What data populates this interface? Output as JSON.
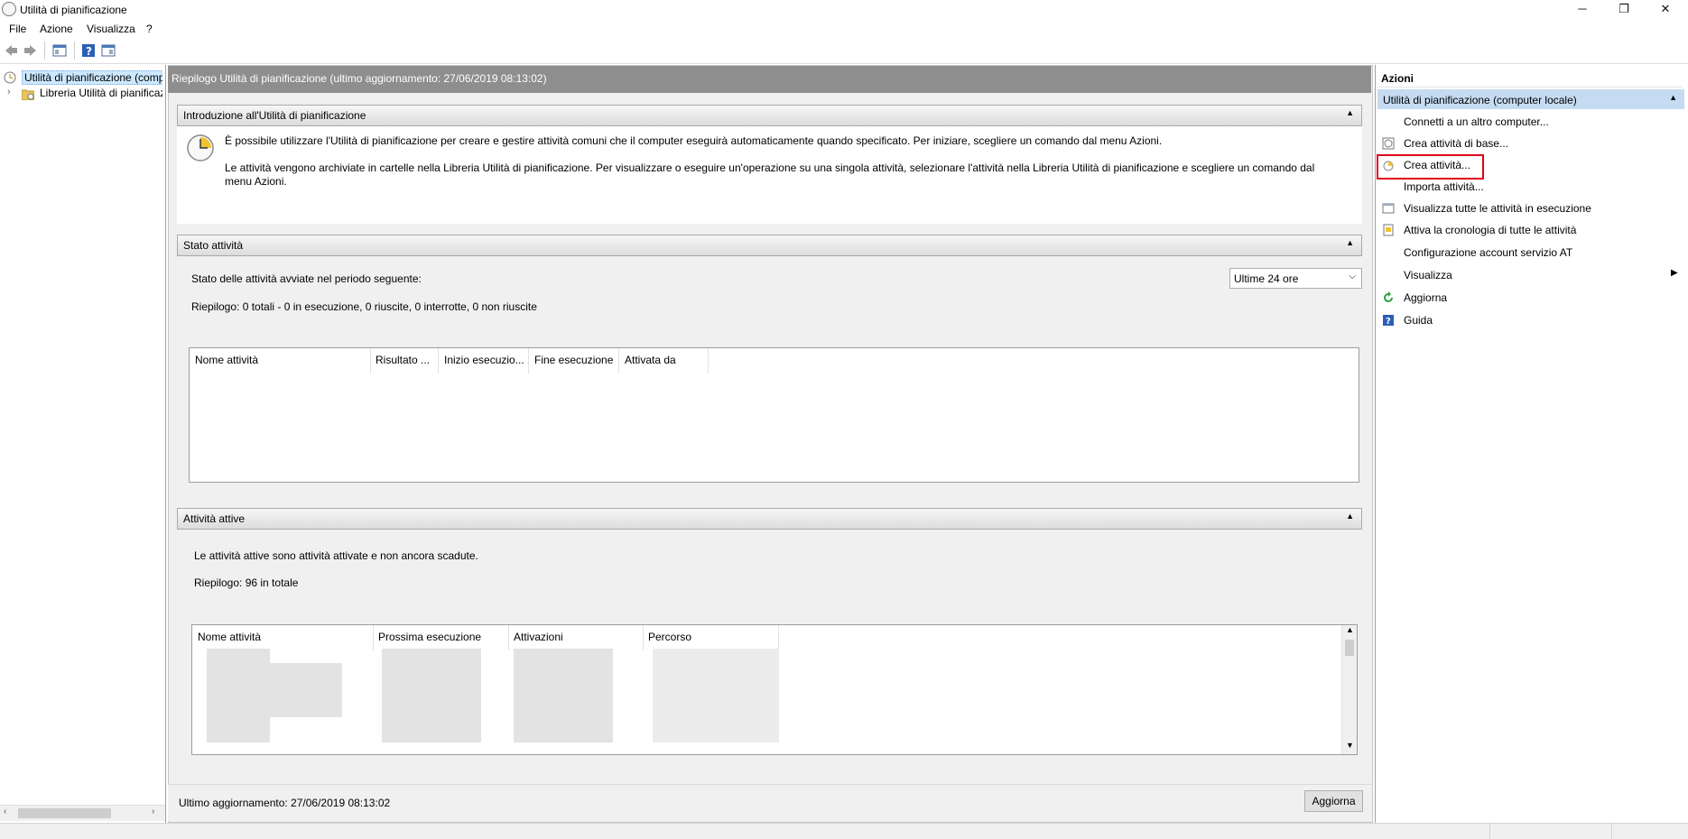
{
  "window": {
    "title": "Utilità di pianificazione",
    "minimize_glyph": "─",
    "restore_glyph": "❐",
    "close_glyph": "✕"
  },
  "menu": [
    "File",
    "Azione",
    "Visualizza",
    "?"
  ],
  "tree": {
    "root": "Utilità di pianificazione (computer locale)",
    "child": "Libreria Utilità di pianificazione"
  },
  "center": {
    "header": "Riepilogo Utilità di pianificazione (ultimo aggiornamento: 27/06/2019 08:13:02)",
    "intro": {
      "title": "Introduzione all'Utilità di pianificazione",
      "p1": "È possibile utilizzare l'Utilità di pianificazione per creare e gestire attività comuni che il computer eseguirà automaticamente quando specificato. Per iniziare, scegliere un comando dal menu Azioni.",
      "p2": "Le attività vengono archiviate in cartelle nella Libreria Utilità di pianificazione. Per visualizzare o eseguire un'operazione su una singola attività, selezionare l'attività nella Libreria Utilità di pianificazione e scegliere un comando dal menu Azioni."
    },
    "status": {
      "title": "Stato attività",
      "period_label": "Stato delle attività avviate nel periodo seguente:",
      "period_value": "Ultime 24 ore",
      "summary": "Riepilogo: 0 totali - 0 in esecuzione, 0 riuscite, 0 interrotte, 0 non riuscite",
      "columns": [
        "Nome attività",
        "Risultato ...",
        "Inizio esecuzio...",
        "Fine esecuzione",
        "Attivata da"
      ]
    },
    "active": {
      "title": "Attività attive",
      "desc": "Le attività attive sono attività attivate e non ancora scadute.",
      "summary": "Riepilogo: 96 in totale",
      "columns": [
        "Nome attività",
        "Prossima esecuzione",
        "Attivazioni",
        "Percorso"
      ]
    },
    "footer": {
      "last_update": "Ultimo aggiornamento: 27/06/2019 08:13:02",
      "refresh_button": "Aggiorna"
    }
  },
  "actions": {
    "title": "Azioni",
    "group": "Utilità di pianificazione (computer locale)",
    "items": [
      {
        "label": "Connetti a un altro computer...",
        "icon": "none"
      },
      {
        "label": "Crea attività di base...",
        "icon": "basic-task-icon"
      },
      {
        "label": "Crea attività...",
        "icon": "create-task-icon",
        "highlighted": true
      },
      {
        "label": "Importa attività...",
        "icon": "none"
      },
      {
        "label": "Visualizza tutte le attività in esecuzione",
        "icon": "running-tasks-icon"
      },
      {
        "label": "Attiva la cronologia di tutte le attività",
        "icon": "history-icon"
      },
      {
        "label": "Configurazione account servizio AT",
        "icon": "none"
      },
      {
        "label": "Visualizza",
        "icon": "none",
        "submenu": true
      },
      {
        "label": "Aggiorna",
        "icon": "refresh-icon"
      },
      {
        "label": "Guida",
        "icon": "help-icon"
      }
    ]
  },
  "colors": {
    "header_gray": "#8e8e8e",
    "selection_blue": "#cce8ff",
    "actions_group_blue": "#c5dbf1",
    "highlight_red": "#e0001a"
  }
}
